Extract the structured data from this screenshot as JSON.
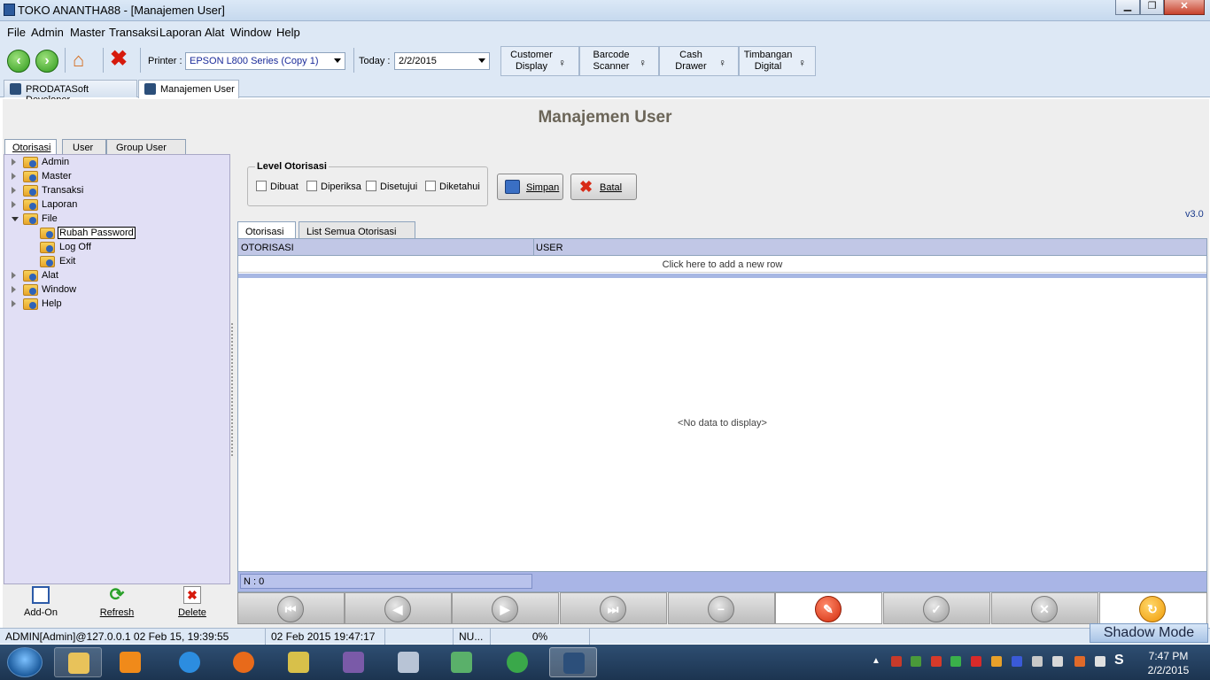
{
  "window": {
    "title": "TOKO ANANTHA88 - [Manajemen User]",
    "min": "▁",
    "max": "❐",
    "close": "✕"
  },
  "menu": [
    "File",
    "Admin",
    "Master",
    "Transaksi",
    "Laporan",
    "Alat",
    "Window",
    "Help"
  ],
  "toolbar": {
    "printer_label": "Printer :",
    "printer_value": "EPSON L800 Series (Copy 1)",
    "today_label": "Today :",
    "today_value": "2/2/2015",
    "devices": [
      {
        "l1": "Customer",
        "l2": "Display"
      },
      {
        "l1": "Barcode",
        "l2": "Scanner"
      },
      {
        "l1": "Cash",
        "l2": "Drawer"
      },
      {
        "l1": "Timbangan",
        "l2": "Digital"
      }
    ]
  },
  "doc_tabs": [
    "PRODATASoft Developer",
    "Manajemen User"
  ],
  "page_title": "Manajemen User",
  "left_tabs": [
    "Otorisasi",
    "User",
    "Group User"
  ],
  "tree": [
    {
      "label": "Admin",
      "expanded": false
    },
    {
      "label": "Master",
      "expanded": false
    },
    {
      "label": "Transaksi",
      "expanded": false
    },
    {
      "label": "Laporan",
      "expanded": false
    },
    {
      "label": "File",
      "expanded": true,
      "children": [
        "Rubah Password",
        "Log Off",
        "Exit"
      ]
    },
    {
      "label": "Alat",
      "expanded": false
    },
    {
      "label": "Window",
      "expanded": false
    },
    {
      "label": "Help",
      "expanded": false
    }
  ],
  "level": {
    "title": "Level Otorisasi",
    "options": [
      "Dibuat",
      "Diperiksa",
      "Disetujui",
      "Diketahui"
    ]
  },
  "buttons": {
    "save": "Simpan",
    "cancel": "Batal"
  },
  "version": "v3.0",
  "grid_tabs": [
    "Otorisasi",
    "List Semua Otorisasi"
  ],
  "grid": {
    "columns": [
      "OTORISASI",
      "USER"
    ],
    "new_row": "Click here to add a new row",
    "empty": "<No data to display>",
    "footer": "N : 0"
  },
  "bottom_tools": [
    "Add-On",
    "Refresh",
    "Delete"
  ],
  "status": {
    "user": "ADMIN[Admin]@127.0.0.1 02 Feb 15, 19:39:55",
    "datetime": "02 Feb 2015 19:47:17",
    "num": "NU...",
    "percent": "0%"
  },
  "shadow_mode": "Shadow Mode",
  "clock": {
    "time": "7:47 PM",
    "date": "2/2/2015"
  },
  "colors": {
    "accent": "#1a3a8c",
    "tree_bg": "#e1dff5",
    "grid_header": "#c1c7e6"
  }
}
